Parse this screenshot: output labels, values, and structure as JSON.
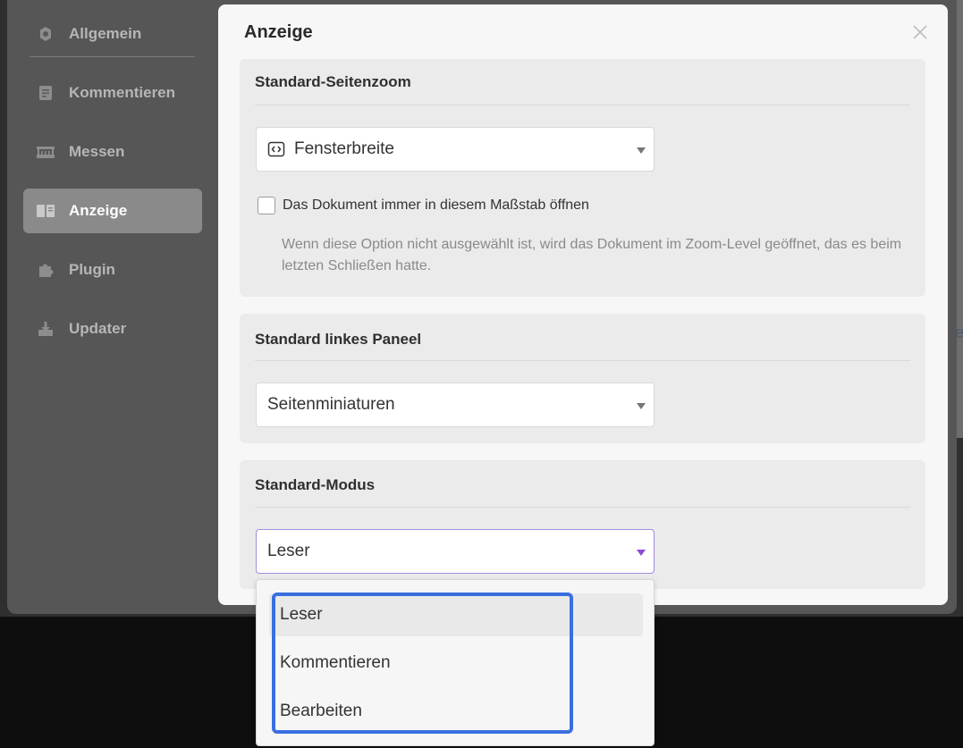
{
  "sidebar": {
    "items": [
      {
        "label": "Allgemein",
        "icon": "gear-icon"
      },
      {
        "label": "Kommentieren",
        "icon": "comment-icon"
      },
      {
        "label": "Messen",
        "icon": "ruler-icon"
      },
      {
        "label": "Anzeige",
        "icon": "book-icon"
      },
      {
        "label": "Plugin",
        "icon": "puzzle-icon"
      },
      {
        "label": "Updater",
        "icon": "download-icon"
      }
    ],
    "active": "Anzeige"
  },
  "dialog": {
    "title": "Anzeige",
    "zoom": {
      "title": "Standard-Seitenzoom",
      "selected": "Fensterbreite",
      "checkbox_label": "Das Dokument immer in diesem Maßstab öffnen",
      "checked": false,
      "hint": "Wenn diese Option nicht ausgewählt ist, wird das Dokument im Zoom-Level geöffnet, das es beim letzten Schließen hatte."
    },
    "left_panel": {
      "title": "Standard linkes Paneel",
      "selected": "Seitenminiaturen"
    },
    "mode": {
      "title": "Standard-Modus",
      "selected": "Leser",
      "options": [
        "Leser",
        "Kommentieren",
        "Bearbeiten"
      ]
    }
  },
  "background": {
    "fragment": "e"
  },
  "colors": {
    "accent": "#8a4bd6",
    "highlight": "#3a6fe0",
    "active_sidebar": "#8a8a8a"
  }
}
